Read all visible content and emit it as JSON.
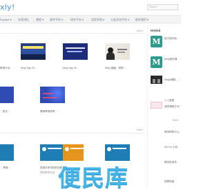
{
  "header": {
    "logo": "xly!",
    "search_placeholder": "Search"
  },
  "nav": {
    "items": [
      "Explore ▾",
      "名家讲坛",
      "课程 ▾",
      "软件平台 ▾",
      "研究平台 ▾",
      "实验学校 ▾",
      "公益活动平台 ▾",
      "联系我们 ▾"
    ]
  },
  "sections": [
    {
      "more": "More ›",
      "captions": [
        "教育行动 …",
        "Moly Day 20…",
        "Moly Day 20…",
        "Moly 直播…李刚…",
        "",
        ""
      ]
    },
    {
      "captions": [
        "…变化 …",
        "基础教育政策 …",
        "",
        "",
        "",
        ""
      ]
    },
    {
      "title": "",
      "more": "More ›",
      "captions": [
        "… 教育 …",
        "探索未来学校的创新与转型…",
        "",
        "",
        "",
        ""
      ],
      "sub_captions": [
        "",
        "国际教育协会",
        ""
      ]
    }
  ],
  "sidebar": {
    "title": "Hotted",
    "items": [
      {
        "label": "官方首页标…",
        "icon": "m-logo-icon"
      },
      {
        "label": "Moly首页课…",
        "icon": "m-logo-icon"
      },
      {
        "label": "Mega课程 - …",
        "icon": "device-icon"
      },
      {
        "label": "人工智能",
        "icon": "blank-icon"
      },
      {
        "label": "我的课程计划",
        "icon": "pink-card-icon"
      },
      {
        "label": "教师研修中心",
        "icon": "blank-icon"
      },
      {
        "label": "Mo Go 小班…",
        "icon": "blank-icon"
      },
      {
        "label": "教务处相关…",
        "icon": "blank-icon"
      },
      {
        "label": "视频电脑",
        "icon": "blank-icon"
      }
    ],
    "more_label": "More ›"
  },
  "watermark": "便民库",
  "colors": {
    "accent": "#4a8fd0",
    "brand_green": "#2f9b8c",
    "watermark_blue": "#47b4e8"
  }
}
